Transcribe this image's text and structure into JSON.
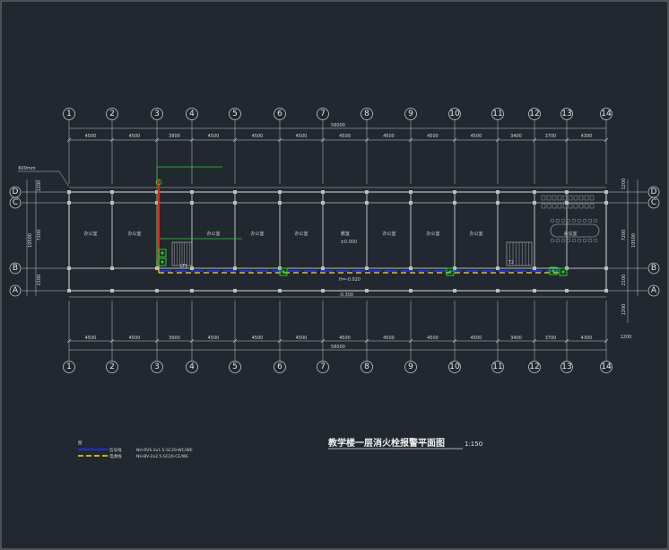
{
  "drawing": {
    "title": "教学楼一层消火栓报警平面图",
    "scale": "1:150",
    "grid_columns": [
      "1",
      "2",
      "3",
      "4",
      "5",
      "6",
      "7",
      "8",
      "9",
      "10",
      "11",
      "12",
      "13",
      "14"
    ],
    "grid_rows": [
      "D",
      "C",
      "B",
      "A"
    ],
    "top_dimensions": [
      "4500",
      "4500",
      "3900",
      "4500",
      "4500",
      "4500",
      "4500",
      "4500",
      "4500",
      "4500",
      "3400",
      "3700",
      "4300"
    ],
    "bottom_dimensions": [
      "4500",
      "4500",
      "3900",
      "4500",
      "4500",
      "4500",
      "4500",
      "4500",
      "4500",
      "4500",
      "3400",
      "3700",
      "4300"
    ],
    "overall_dimension": "56000",
    "left_dimensions": [
      "1200",
      "7200",
      "2100"
    ],
    "left_total": "10500",
    "right_dimensions": [
      "1200",
      "7200",
      "2100",
      "1200"
    ],
    "right_total": "10500",
    "right_bottom_dimension": "1200",
    "note_left": "600mm",
    "elevation_marks": [
      "±0.000",
      "H=-0.020",
      "-0.300"
    ],
    "rooms": [
      {
        "label": "办公室"
      },
      {
        "label": "办公室"
      },
      {
        "label": "办公室"
      },
      {
        "label": "办公室"
      },
      {
        "label": "办公室"
      },
      {
        "label": "教室"
      },
      {
        "label": "办公室"
      },
      {
        "label": "办公室"
      },
      {
        "label": "办公室"
      },
      {
        "label": "会议室"
      }
    ],
    "stair_labels": [
      "LT1",
      "T2"
    ],
    "legend": {
      "heading": "图",
      "items": [
        {
          "label": "信号线",
          "spec": "NH-RVS-2x1.5-SC20-WC/WE",
          "color": "#1c2fe0"
        },
        {
          "label": "电源线",
          "spec": "NH-BV-2x2.5-SC20-CE/WE",
          "color": "#ffe000"
        }
      ]
    },
    "colors": {
      "background": "#212830",
      "grid_line": "#c8c8c8",
      "wall": "#bdbdbd",
      "signal_line": "#1c2fe0",
      "power_line": "#ffe000",
      "riser_red": "#ff1a1a",
      "device_green": "#1ed61e"
    }
  }
}
